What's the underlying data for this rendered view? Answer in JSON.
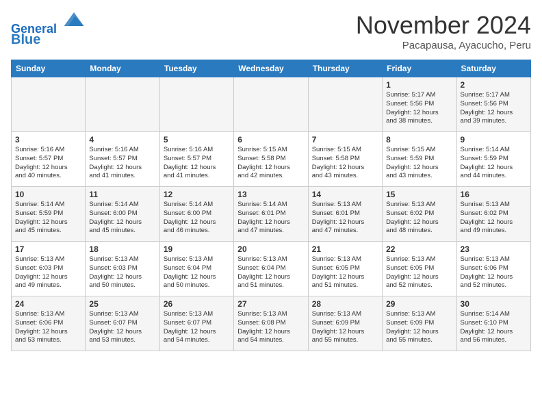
{
  "header": {
    "logo_line1": "General",
    "logo_line2": "Blue",
    "month_title": "November 2024",
    "subtitle": "Pacapausa, Ayacucho, Peru"
  },
  "weekdays": [
    "Sunday",
    "Monday",
    "Tuesday",
    "Wednesday",
    "Thursday",
    "Friday",
    "Saturday"
  ],
  "weeks": [
    [
      {
        "day": "",
        "info": ""
      },
      {
        "day": "",
        "info": ""
      },
      {
        "day": "",
        "info": ""
      },
      {
        "day": "",
        "info": ""
      },
      {
        "day": "",
        "info": ""
      },
      {
        "day": "1",
        "info": "Sunrise: 5:17 AM\nSunset: 5:56 PM\nDaylight: 12 hours\nand 38 minutes."
      },
      {
        "day": "2",
        "info": "Sunrise: 5:17 AM\nSunset: 5:56 PM\nDaylight: 12 hours\nand 39 minutes."
      }
    ],
    [
      {
        "day": "3",
        "info": "Sunrise: 5:16 AM\nSunset: 5:57 PM\nDaylight: 12 hours\nand 40 minutes."
      },
      {
        "day": "4",
        "info": "Sunrise: 5:16 AM\nSunset: 5:57 PM\nDaylight: 12 hours\nand 41 minutes."
      },
      {
        "day": "5",
        "info": "Sunrise: 5:16 AM\nSunset: 5:57 PM\nDaylight: 12 hours\nand 41 minutes."
      },
      {
        "day": "6",
        "info": "Sunrise: 5:15 AM\nSunset: 5:58 PM\nDaylight: 12 hours\nand 42 minutes."
      },
      {
        "day": "7",
        "info": "Sunrise: 5:15 AM\nSunset: 5:58 PM\nDaylight: 12 hours\nand 43 minutes."
      },
      {
        "day": "8",
        "info": "Sunrise: 5:15 AM\nSunset: 5:59 PM\nDaylight: 12 hours\nand 43 minutes."
      },
      {
        "day": "9",
        "info": "Sunrise: 5:14 AM\nSunset: 5:59 PM\nDaylight: 12 hours\nand 44 minutes."
      }
    ],
    [
      {
        "day": "10",
        "info": "Sunrise: 5:14 AM\nSunset: 5:59 PM\nDaylight: 12 hours\nand 45 minutes."
      },
      {
        "day": "11",
        "info": "Sunrise: 5:14 AM\nSunset: 6:00 PM\nDaylight: 12 hours\nand 45 minutes."
      },
      {
        "day": "12",
        "info": "Sunrise: 5:14 AM\nSunset: 6:00 PM\nDaylight: 12 hours\nand 46 minutes."
      },
      {
        "day": "13",
        "info": "Sunrise: 5:14 AM\nSunset: 6:01 PM\nDaylight: 12 hours\nand 47 minutes."
      },
      {
        "day": "14",
        "info": "Sunrise: 5:13 AM\nSunset: 6:01 PM\nDaylight: 12 hours\nand 47 minutes."
      },
      {
        "day": "15",
        "info": "Sunrise: 5:13 AM\nSunset: 6:02 PM\nDaylight: 12 hours\nand 48 minutes."
      },
      {
        "day": "16",
        "info": "Sunrise: 5:13 AM\nSunset: 6:02 PM\nDaylight: 12 hours\nand 49 minutes."
      }
    ],
    [
      {
        "day": "17",
        "info": "Sunrise: 5:13 AM\nSunset: 6:03 PM\nDaylight: 12 hours\nand 49 minutes."
      },
      {
        "day": "18",
        "info": "Sunrise: 5:13 AM\nSunset: 6:03 PM\nDaylight: 12 hours\nand 50 minutes."
      },
      {
        "day": "19",
        "info": "Sunrise: 5:13 AM\nSunset: 6:04 PM\nDaylight: 12 hours\nand 50 minutes."
      },
      {
        "day": "20",
        "info": "Sunrise: 5:13 AM\nSunset: 6:04 PM\nDaylight: 12 hours\nand 51 minutes."
      },
      {
        "day": "21",
        "info": "Sunrise: 5:13 AM\nSunset: 6:05 PM\nDaylight: 12 hours\nand 51 minutes."
      },
      {
        "day": "22",
        "info": "Sunrise: 5:13 AM\nSunset: 6:05 PM\nDaylight: 12 hours\nand 52 minutes."
      },
      {
        "day": "23",
        "info": "Sunrise: 5:13 AM\nSunset: 6:06 PM\nDaylight: 12 hours\nand 52 minutes."
      }
    ],
    [
      {
        "day": "24",
        "info": "Sunrise: 5:13 AM\nSunset: 6:06 PM\nDaylight: 12 hours\nand 53 minutes."
      },
      {
        "day": "25",
        "info": "Sunrise: 5:13 AM\nSunset: 6:07 PM\nDaylight: 12 hours\nand 53 minutes."
      },
      {
        "day": "26",
        "info": "Sunrise: 5:13 AM\nSunset: 6:07 PM\nDaylight: 12 hours\nand 54 minutes."
      },
      {
        "day": "27",
        "info": "Sunrise: 5:13 AM\nSunset: 6:08 PM\nDaylight: 12 hours\nand 54 minutes."
      },
      {
        "day": "28",
        "info": "Sunrise: 5:13 AM\nSunset: 6:09 PM\nDaylight: 12 hours\nand 55 minutes."
      },
      {
        "day": "29",
        "info": "Sunrise: 5:13 AM\nSunset: 6:09 PM\nDaylight: 12 hours\nand 55 minutes."
      },
      {
        "day": "30",
        "info": "Sunrise: 5:14 AM\nSunset: 6:10 PM\nDaylight: 12 hours\nand 56 minutes."
      }
    ]
  ]
}
